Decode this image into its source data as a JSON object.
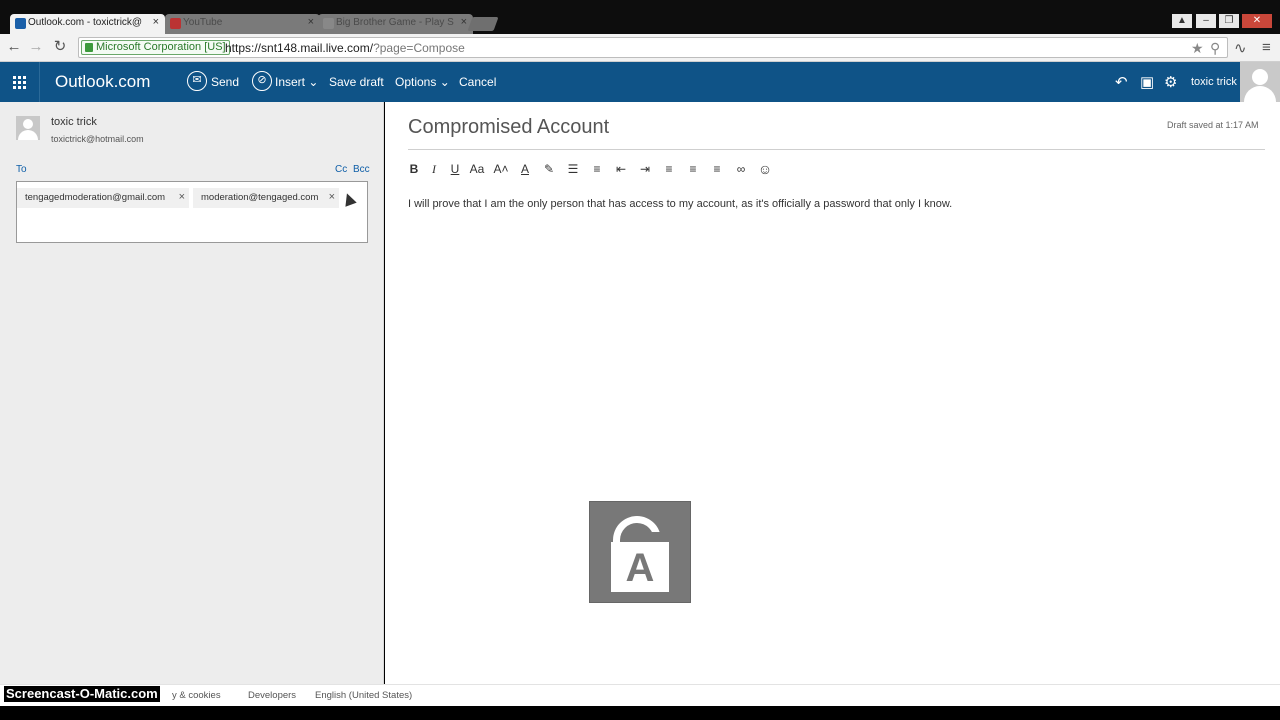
{
  "browser": {
    "tabs": [
      {
        "title": "Outlook.com - toxictrick@",
        "active": true
      },
      {
        "title": "YouTube",
        "active": false
      },
      {
        "title": "Big Brother Game - Play S",
        "active": false
      }
    ],
    "ev_badge": "Microsoft Corporation [US]",
    "url_main": "https://snt148.mail.live.com/",
    "url_rest": "?page=Compose"
  },
  "header": {
    "brand": "Outlook.com",
    "commands": {
      "send": "Send",
      "insert": "Insert",
      "save_draft": "Save draft",
      "options": "Options",
      "cancel": "Cancel"
    },
    "username": "toxic trick"
  },
  "compose": {
    "from_name": "toxic trick",
    "from_email": "toxictrick@hotmail.com",
    "to_label": "To",
    "cc_label": "Cc",
    "bcc_label": "Bcc",
    "recipients": [
      "tengagedmoderation@gmail.com",
      "moderation@tengaged.com"
    ],
    "subject": "Compromised Account",
    "draft_status": "Draft saved at 1:17 AM",
    "body": "I will prove that I am the only person that has access to my account, as it's officially a password that only I know."
  },
  "toolbar_icons": [
    "bold-icon",
    "italic-icon",
    "underline-icon",
    "font-icon",
    "font-size-icon",
    "font-color-icon",
    "highlight-icon",
    "numbered-list-icon",
    "bullet-list-icon",
    "decrease-indent-icon",
    "increase-indent-icon",
    "align-left-icon",
    "align-center-icon",
    "align-right-icon",
    "link-icon",
    "emoji-icon"
  ],
  "toolbar_glyphs": {
    "bold": "B",
    "italic": "I",
    "underline": "U",
    "font": "Aa",
    "font_size": "A˄",
    "font_color": "A",
    "highlight": "✎",
    "numbered_list": "☰",
    "bullet_list": "≡",
    "outdent": "⇤",
    "indent": "⇥",
    "align_left": "≡",
    "align_center": "≡",
    "align_right": "≡",
    "link": "∞",
    "emoji": "☺"
  },
  "lock_logo_letter": "A",
  "footer": {
    "privacy": "y & cookies",
    "developers": "Developers",
    "language": "English (United States)"
  },
  "watermark": "Screencast-O-Matic.com",
  "colors": {
    "header_bg": "#0f5387",
    "link": "#0f5fa8",
    "left_pane_bg": "#ededed"
  }
}
